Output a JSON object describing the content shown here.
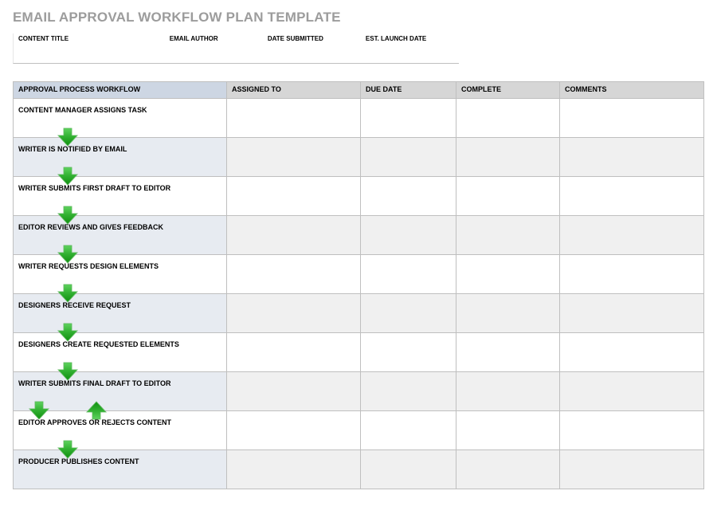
{
  "title": "EMAIL APPROVAL WORKFLOW PLAN TEMPLATE",
  "meta": {
    "content_title_label": "CONTENT TITLE",
    "email_author_label": "EMAIL AUTHOR",
    "date_submitted_label": "DATE SUBMITTED",
    "est_launch_date_label": "EST. LAUNCH DATE",
    "content_title_value": "",
    "email_author_value": "",
    "date_submitted_value": "",
    "est_launch_date_value": ""
  },
  "columns": {
    "workflow": "APPROVAL PROCESS WORKFLOW",
    "assigned": "ASSIGNED TO",
    "due": "DUE DATE",
    "complete": "COMPLETE",
    "comments": "COMMENTS"
  },
  "steps": [
    {
      "label": "CONTENT MANAGER ASSIGNS TASK",
      "assigned": "",
      "due": "",
      "complete": "",
      "comments": ""
    },
    {
      "label": "WRITER IS NOTIFIED BY EMAIL",
      "assigned": "",
      "due": "",
      "complete": "",
      "comments": ""
    },
    {
      "label": "WRITER SUBMITS FIRST DRAFT TO EDITOR",
      "assigned": "",
      "due": "",
      "complete": "",
      "comments": ""
    },
    {
      "label": "EDITOR REVIEWS AND GIVES FEEDBACK",
      "assigned": "",
      "due": "",
      "complete": "",
      "comments": ""
    },
    {
      "label": "WRITER REQUESTS DESIGN ELEMENTS",
      "assigned": "",
      "due": "",
      "complete": "",
      "comments": ""
    },
    {
      "label": "DESIGNERS RECEIVE REQUEST",
      "assigned": "",
      "due": "",
      "complete": "",
      "comments": ""
    },
    {
      "label": "DESIGNERS CREATE REQUESTED ELEMENTS",
      "assigned": "",
      "due": "",
      "complete": "",
      "comments": ""
    },
    {
      "label": "WRITER SUBMITS FINAL DRAFT TO EDITOR",
      "assigned": "",
      "due": "",
      "complete": "",
      "comments": ""
    },
    {
      "label": "EDITOR APPROVES OR REJECTS CONTENT",
      "assigned": "",
      "due": "",
      "complete": "",
      "comments": ""
    },
    {
      "label": "PRODUCER PUBLISHES CONTENT",
      "assigned": "",
      "due": "",
      "complete": "",
      "comments": ""
    }
  ],
  "colors": {
    "header_workflow": "#cdd6e3",
    "header_other": "#d6d6d6",
    "alt_workflow": "#e7ebf1",
    "alt_other": "#f0f0f0",
    "arrow_top": "#4db64d",
    "arrow_bottom": "#1f9d1f"
  }
}
